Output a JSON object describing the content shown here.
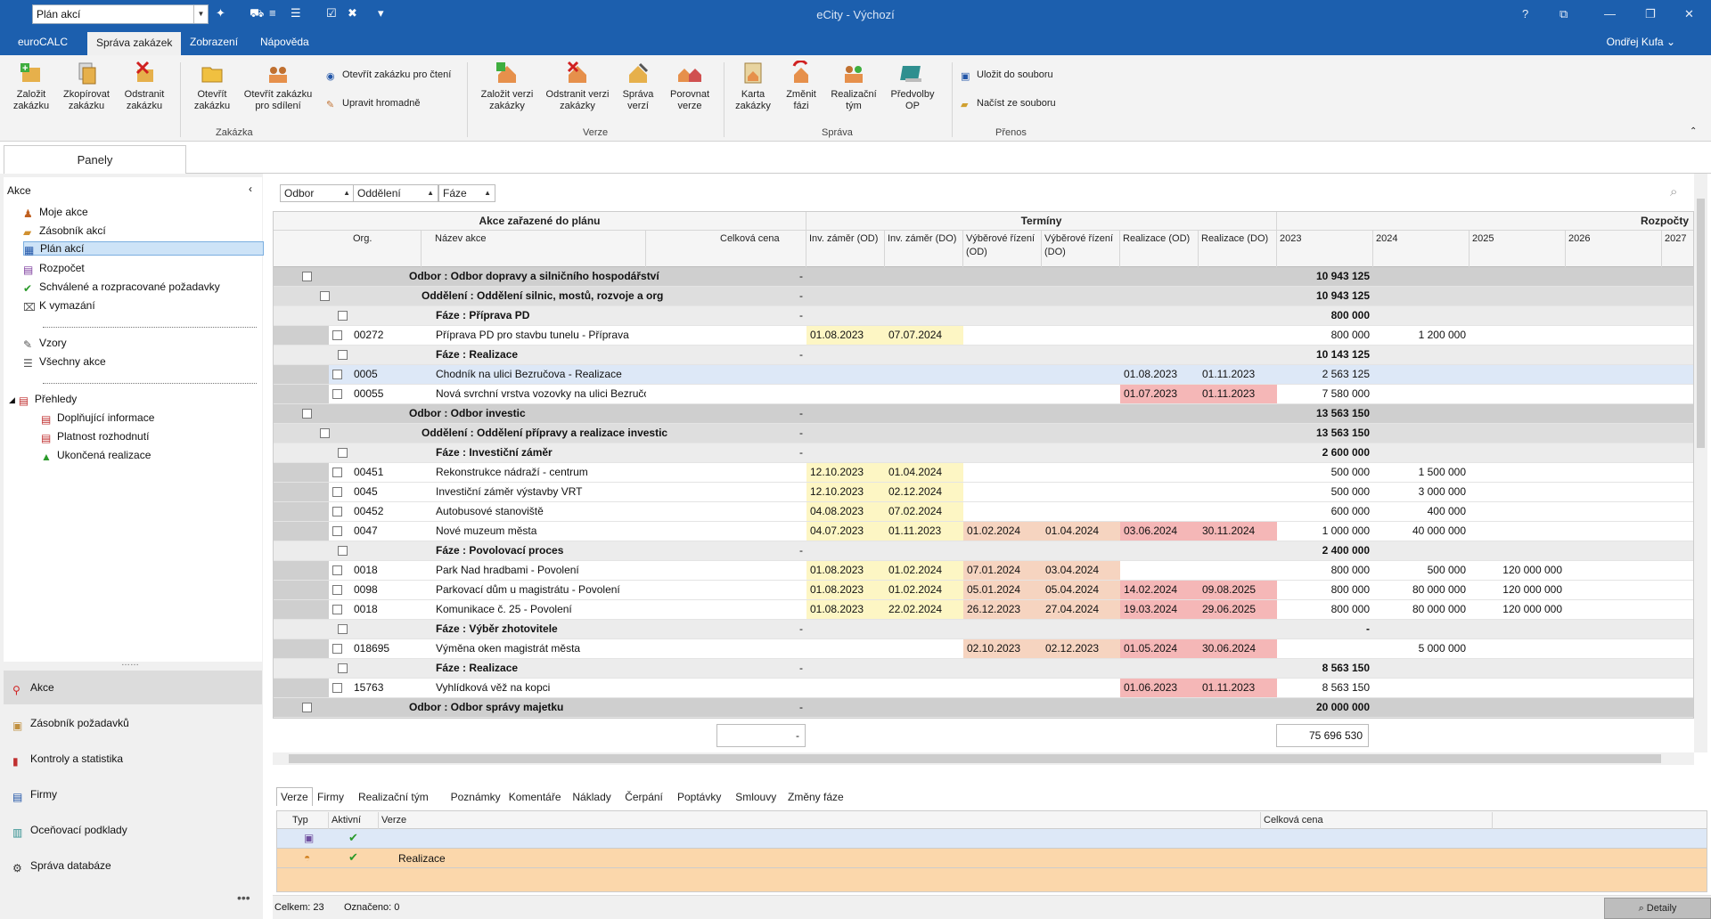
{
  "titlebar": {
    "view_select": "Plán akcí",
    "app_title": "eCity - Výchozí",
    "help": "?"
  },
  "menubar": {
    "tabs": [
      "euroCALC",
      "Správa zakázek",
      "Zobrazení",
      "Nápověda"
    ],
    "user": "Ondřej Kufa"
  },
  "ribbon": {
    "zakazka": {
      "group": "Zakázka",
      "zalozit": "Založit zakázku",
      "zkopirovat": "Zkopírovat zakázku",
      "odstranit": "Odstranit zakázku",
      "otevrit": "Otevřít zakázku",
      "otevrit_sdileni": "Otevřít zakázku pro sdílení",
      "otevrit_cteni": "Otevřít zakázku pro čtení",
      "upravit_hromadne": "Upravit hromadně"
    },
    "verze": {
      "group": "Verze",
      "zalozit": "Založit verzi zakázky",
      "odstranit": "Odstranit verzi zakázky",
      "sprava": "Správa verzí",
      "porovnat": "Porovnat verze"
    },
    "sprava": {
      "group": "Správa",
      "karta": "Karta zakázky",
      "zmenit": "Změnit fázi",
      "tym": "Realizační tým",
      "predvolby": "Předvolby OP"
    },
    "prenos": {
      "group": "Přenos",
      "ulozit": "Uložit do souboru",
      "nacist": "Načíst ze souboru"
    }
  },
  "left": {
    "panely": "Panely",
    "section": "Akce",
    "items": [
      "Moje akce",
      "Zásobník akcí",
      "Plán akcí",
      "Rozpočet",
      "Schválené a rozpracované požadavky",
      "K vymazání",
      "Vzory",
      "Všechny akce",
      "Přehledy",
      "Doplňující informace",
      "Platnost rozhodnutí",
      "Ukončená realizace"
    ],
    "nav": [
      "Akce",
      "Zásobník požadavků",
      "Kontroly a statistika",
      "Firmy",
      "Oceňovací podklady",
      "Správa databáze"
    ]
  },
  "filters": [
    "Odbor",
    "Oddělení",
    "Fáze"
  ],
  "grid": {
    "groups": {
      "akce": "Akce zařazené do plánu",
      "terminy": "Termíny",
      "rozpocty": "Rozpočty"
    },
    "headers": [
      "Org.",
      "Název akce",
      "Celková cena",
      "Inv. záměr (OD)",
      "Inv. záměr (DO)",
      "Výběrové řízení (OD)",
      "Výběrové řízení (DO)",
      "Realizace (OD)",
      "Realizace (DO)",
      "2023",
      "2024",
      "2025",
      "2026",
      "2027"
    ],
    "rows": [
      {
        "lvl": 0,
        "name": "Odbor : Odbor dopravy a silničního hospodářství",
        "cena": "-",
        "y2023": "10 943 125"
      },
      {
        "lvl": 1,
        "name": "Oddělení : Oddělení silnic, mostů, rozvoje a org",
        "cena": "-",
        "y2023": "10 943 125"
      },
      {
        "lvl": 2,
        "name": "Fáze : Příprava PD",
        "cena": "-",
        "y2023": "800 000"
      },
      {
        "lvl": 3,
        "org": "00272",
        "name": "Příprava PD pro stavbu tunelu - Příprava",
        "iz_od": "01.08.2023",
        "iz_do": "07.07.2024",
        "y2023": "800 000",
        "y2024": "1 200 000"
      },
      {
        "lvl": 2,
        "name": "Fáze : Realizace",
        "cena": "-",
        "y2023": "10 143 125"
      },
      {
        "lvl": 3,
        "org": "0005",
        "name": "Chodník na ulici Bezručova - Realizace",
        "r_od": "01.08.2023",
        "r_do": "01.11.2023",
        "y2023": "2 563 125",
        "sel": true
      },
      {
        "lvl": 3,
        "org": "00055",
        "name": "Nová svrchní vrstva vozovky na ulici Bezručova - Rea...",
        "r_od": "01.07.2023",
        "r_do": "01.11.2023",
        "y2023": "7 580 000",
        "pinkR": true
      },
      {
        "lvl": 0,
        "name": "Odbor : Odbor investic",
        "cena": "-",
        "y2023": "13 563 150"
      },
      {
        "lvl": 1,
        "name": "Oddělení : Oddělení přípravy a realizace investic",
        "cena": "-",
        "y2023": "13 563 150"
      },
      {
        "lvl": 2,
        "name": "Fáze : Investiční záměr",
        "cena": "-",
        "y2023": "2 600 000"
      },
      {
        "lvl": 3,
        "org": "00451",
        "name": "Rekonstrukce nádraží - centrum",
        "iz_od": "12.10.2023",
        "iz_do": "01.04.2024",
        "y2023": "500 000",
        "y2024": "1 500 000"
      },
      {
        "lvl": 3,
        "org": "0045",
        "name": "Investiční záměr výstavby VRT",
        "iz_od": "12.10.2023",
        "iz_do": "02.12.2024",
        "y2023": "500 000",
        "y2024": "3 000 000"
      },
      {
        "lvl": 3,
        "org": "00452",
        "name": "Autobusové stanoviště",
        "iz_od": "04.08.2023",
        "iz_do": "07.02.2024",
        "y2023": "600 000",
        "y2024": "400 000"
      },
      {
        "lvl": 3,
        "org": "0047",
        "name": "Nové muzeum města",
        "iz_od": "04.07.2023",
        "iz_do": "01.11.2023",
        "vr_od": "01.02.2024",
        "vr_do": "01.04.2024",
        "r_od": "03.06.2024",
        "r_do": "30.11.2024",
        "y2023": "1 000 000",
        "y2024": "40 000 000",
        "pinkR": true
      },
      {
        "lvl": 2,
        "name": "Fáze : Povolovací proces",
        "cena": "-",
        "y2023": "2 400 000"
      },
      {
        "lvl": 3,
        "org": "0018",
        "name": "Park Nad hradbami - Povolení",
        "iz_od": "01.08.2023",
        "iz_do": "01.02.2024",
        "vr_od": "07.01.2024",
        "vr_do": "03.04.2024",
        "y2023": "800 000",
        "y2024": "500 000",
        "y2025": "120 000 000"
      },
      {
        "lvl": 3,
        "org": "0098",
        "name": "Parkovací dům u magistrátu - Povolení",
        "iz_od": "01.08.2023",
        "iz_do": "01.02.2024",
        "vr_od": "05.01.2024",
        "vr_do": "05.04.2024",
        "r_od": "14.02.2024",
        "r_do": "09.08.2025",
        "y2023": "800 000",
        "y2024": "80 000 000",
        "y2025": "120 000 000",
        "pinkR": true
      },
      {
        "lvl": 3,
        "org": "0018",
        "name": "Komunikace č. 25 - Povolení",
        "iz_od": "01.08.2023",
        "iz_do": "22.02.2024",
        "vr_od": "26.12.2023",
        "vr_do": "27.04.2024",
        "r_od": "19.03.2024",
        "r_do": "29.06.2025",
        "y2023": "800 000",
        "y2024": "80 000 000",
        "y2025": "120 000 000",
        "pinkR": true
      },
      {
        "lvl": 2,
        "name": "Fáze : Výběr zhotovitele",
        "cena": "-",
        "y2023": "-"
      },
      {
        "lvl": 3,
        "org": "018695",
        "name": "Výměna oken magistrát města",
        "vr_od": "02.10.2023",
        "vr_do": "02.12.2023",
        "r_od": "01.05.2024",
        "r_do": "30.06.2024",
        "y2024": "5 000 000",
        "pinkR": true
      },
      {
        "lvl": 2,
        "name": "Fáze : Realizace",
        "cena": "-",
        "y2023": "8 563 150"
      },
      {
        "lvl": 3,
        "org": "15763",
        "name": "Vyhlídková věž na kopci",
        "r_od": "01.06.2023",
        "r_do": "01.11.2023",
        "y2023": "8 563 150",
        "pinkR": true
      },
      {
        "lvl": 0,
        "name": "Odbor : Odbor správy majetku",
        "cena": "-",
        "y2023": "20 000 000"
      }
    ],
    "total_cena": "-",
    "total_2023": "75 696 530"
  },
  "bottom": {
    "tabs": [
      "Verze",
      "Firmy",
      "Realizační tým",
      "Poznámky",
      "Komentáře",
      "Náklady",
      "Čerpání",
      "Poptávky",
      "Smlouvy",
      "Změny fáze"
    ],
    "headers": [
      "Typ",
      "Aktivní",
      "Verze",
      "Celková cena"
    ],
    "row2_verze": "Realizace"
  },
  "status": {
    "celkem": "Celkem: 23",
    "oznaceno": "Označeno: 0",
    "detaily": "Detaily"
  }
}
